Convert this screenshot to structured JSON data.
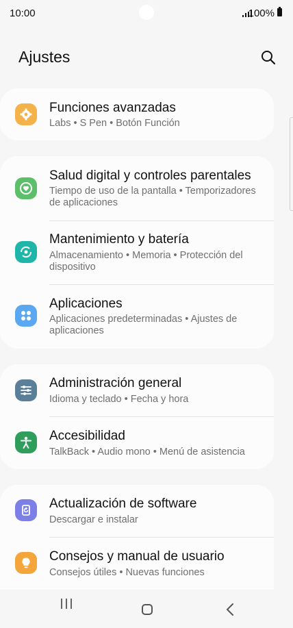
{
  "status": {
    "time": "10:00",
    "battery": "100%"
  },
  "header": {
    "title": "Ajustes"
  },
  "rows": [
    {
      "title": "Funciones avanzadas",
      "subtitle": "Labs  •  S Pen  •  Botón Función",
      "icon": "gear-icon",
      "color": "#f4b24b"
    },
    {
      "title": "Salud digital y controles parentales",
      "subtitle": "Tiempo de uso de la pantalla  •  Temporizadores de aplicaciones",
      "icon": "heart-circle-icon",
      "color": "#5ebf6a"
    },
    {
      "title": "Mantenimiento y batería",
      "subtitle": "Almacenamiento  •  Memoria  •  Protección del dispositivo",
      "icon": "refresh-circle-icon",
      "color": "#1fb5a8"
    },
    {
      "title": "Aplicaciones",
      "subtitle": "Aplicaciones predeterminadas  •  Ajustes de aplicaciones",
      "icon": "apps-grid-icon",
      "color": "#5ba7f2"
    },
    {
      "title": "Administración general",
      "subtitle": "Idioma y teclado  •  Fecha y hora",
      "icon": "sliders-icon",
      "color": "#5b7f98"
    },
    {
      "title": "Accesibilidad",
      "subtitle": "TalkBack  •  Audio mono  •  Menú de asistencia",
      "icon": "person-icon",
      "color": "#2f9e5c"
    },
    {
      "title": "Actualización de software",
      "subtitle": "Descargar e instalar",
      "icon": "update-icon",
      "color": "#7b7fe6"
    },
    {
      "title": "Consejos y manual de usuario",
      "subtitle": "Consejos útiles  •  Nuevas funciones",
      "icon": "lightbulb-icon",
      "color": "#f4a53b"
    }
  ]
}
